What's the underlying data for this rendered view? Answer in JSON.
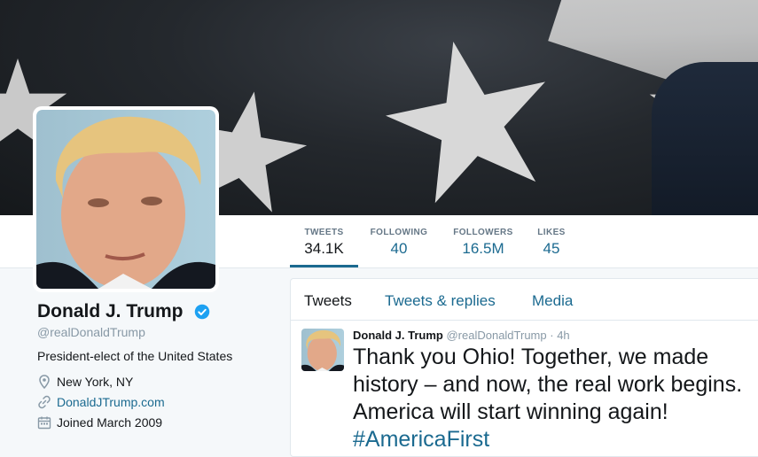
{
  "profile": {
    "name": "Donald J. Trump",
    "handle": "@realDonaldTrump",
    "bio": "President-elect of the United States",
    "location": "New York, NY",
    "website": "DonaldJTrump.com",
    "joined": "Joined March 2009",
    "verified_icon": "verified-badge-icon"
  },
  "stats": [
    {
      "label": "TWEETS",
      "value": "34.1K"
    },
    {
      "label": "FOLLOWING",
      "value": "40"
    },
    {
      "label": "FOLLOWERS",
      "value": "16.5M"
    },
    {
      "label": "LIKES",
      "value": "45"
    }
  ],
  "tabs": [
    {
      "label": "Tweets"
    },
    {
      "label": "Tweets & replies"
    },
    {
      "label": "Media"
    }
  ],
  "tweet": {
    "name": "Donald J. Trump",
    "handle": "@realDonaldTrump",
    "time": "· 4h",
    "line1": "Thank you Ohio! Together, we made",
    "line2": "history – and now, the real work begins.",
    "line3": "America will start winning again!",
    "hashtag": "#AmericaFirst"
  },
  "colors": {
    "accent": "#1b6a90",
    "verified": "#1da1f2",
    "muted": "#8899a6"
  }
}
